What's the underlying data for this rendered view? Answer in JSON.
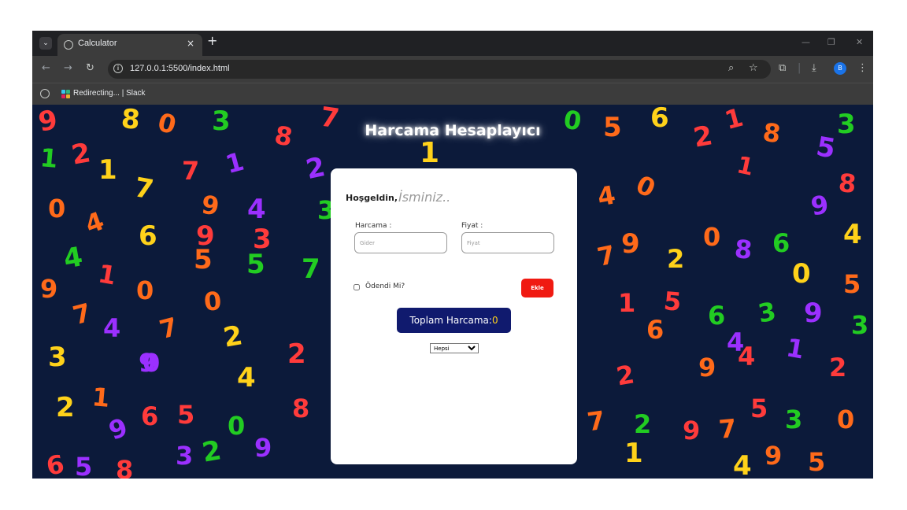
{
  "browser": {
    "tab_title": "Calculator",
    "tab_close": "×",
    "new_tab": "+",
    "tab_menu": "⌄",
    "url": "127.0.0.1:5500/index.html",
    "profile_initial": "B",
    "bookmark_label": "Redirecting... | Slack",
    "icons": [
      "back-icon",
      "forward-icon",
      "reload-icon",
      "info-icon",
      "zoom-icon",
      "star-icon",
      "extensions-icon",
      "download-icon",
      "menu-icon"
    ]
  },
  "page": {
    "title": "Harcama Hesaplayıcı",
    "welcome_label": "Hoşgeldin,",
    "name_placeholder": "İsminiz..",
    "expense_label": "Harcama :",
    "expense_placeholder": "Gider",
    "price_label": "Fiyat :",
    "price_placeholder": "Fiyat",
    "paid_label": "Ödendi Mi?",
    "add_button": "Ekle",
    "total_label": "Toplam Harcama:",
    "total_value": "0",
    "filter_selected": "Hepsi"
  },
  "background_digits": [
    {
      "d": "9",
      "c": "#ff3b3b"
    },
    {
      "d": "8",
      "c": "#ffd21a"
    },
    {
      "d": "0",
      "c": "#ff6a1a"
    },
    {
      "d": "3",
      "c": "#22cc22"
    },
    {
      "d": "8",
      "c": "#ff3b3b"
    },
    {
      "d": "7",
      "c": "#ff3b3b"
    },
    {
      "d": "2",
      "c": "#9b30ff"
    },
    {
      "d": "1",
      "c": "#ffd21a"
    },
    {
      "d": "0",
      "c": "#22cc22"
    },
    {
      "d": "5",
      "c": "#ff6a1a"
    },
    {
      "d": "6",
      "c": "#ffd21a"
    },
    {
      "d": "2",
      "c": "#ff3b3b"
    },
    {
      "d": "1",
      "c": "#ff3b3b"
    },
    {
      "d": "8",
      "c": "#ff6a1a"
    },
    {
      "d": "3",
      "c": "#22cc22"
    },
    {
      "d": "5",
      "c": "#9b30ff"
    },
    {
      "d": "1",
      "c": "#22cc22"
    },
    {
      "d": "2",
      "c": "#ff3b3b"
    },
    {
      "d": "1",
      "c": "#ffd21a"
    },
    {
      "d": "7",
      "c": "#ff3b3b"
    },
    {
      "d": "1",
      "c": "#9b30ff"
    },
    {
      "d": "7",
      "c": "#ffd21a"
    },
    {
      "d": "9",
      "c": "#ff6a1a"
    },
    {
      "d": "4",
      "c": "#9b30ff"
    },
    {
      "d": "0",
      "c": "#ff6a1a"
    },
    {
      "d": "4",
      "c": "#ff6a1a"
    },
    {
      "d": "3",
      "c": "#22cc22"
    },
    {
      "d": "1",
      "c": "#ff3b3b"
    },
    {
      "d": "9",
      "c": "#9b30ff"
    },
    {
      "d": "8",
      "c": "#ff3b3b"
    },
    {
      "d": "4",
      "c": "#ff6a1a"
    },
    {
      "d": "0",
      "c": "#ff6a1a"
    },
    {
      "d": "6",
      "c": "#ffd21a"
    },
    {
      "d": "9",
      "c": "#ff3b3b"
    },
    {
      "d": "3",
      "c": "#ff3b3b"
    },
    {
      "d": "4",
      "c": "#22cc22"
    },
    {
      "d": "7",
      "c": "#ff6a1a"
    },
    {
      "d": "9",
      "c": "#ff6a1a"
    },
    {
      "d": "2",
      "c": "#ffd21a"
    },
    {
      "d": "0",
      "c": "#ff6a1a"
    },
    {
      "d": "8",
      "c": "#9b30ff"
    },
    {
      "d": "6",
      "c": "#22cc22"
    },
    {
      "d": "4",
      "c": "#ffd21a"
    },
    {
      "d": "1",
      "c": "#ff3b3b"
    },
    {
      "d": "5",
      "c": "#ff6a1a"
    },
    {
      "d": "5",
      "c": "#22cc22"
    },
    {
      "d": "7",
      "c": "#22cc22"
    },
    {
      "d": "9",
      "c": "#ff6a1a"
    },
    {
      "d": "0",
      "c": "#ffd21a"
    },
    {
      "d": "5",
      "c": "#ff6a1a"
    },
    {
      "d": "0",
      "c": "#ff6a1a"
    },
    {
      "d": "0",
      "c": "#ff6a1a"
    },
    {
      "d": "7",
      "c": "#ff6a1a"
    },
    {
      "d": "4",
      "c": "#9b30ff"
    },
    {
      "d": "1",
      "c": "#ff3b3b"
    },
    {
      "d": "7",
      "c": "#ff6a1a"
    },
    {
      "d": "5",
      "c": "#ff3b3b"
    },
    {
      "d": "6",
      "c": "#22cc22"
    },
    {
      "d": "3",
      "c": "#22cc22"
    },
    {
      "d": "9",
      "c": "#9b30ff"
    },
    {
      "d": "3",
      "c": "#22cc22"
    },
    {
      "d": "6",
      "c": "#ff6a1a"
    },
    {
      "d": "3",
      "c": "#ffd21a"
    },
    {
      "d": "4",
      "c": "#9b30ff"
    },
    {
      "d": "0",
      "c": "#9b30ff"
    },
    {
      "d": "2",
      "c": "#ffd21a"
    },
    {
      "d": "2",
      "c": "#ff3b3b"
    },
    {
      "d": "4",
      "c": "#ff3b3b"
    },
    {
      "d": "1",
      "c": "#9b30ff"
    },
    {
      "d": "4",
      "c": "#ffd21a"
    },
    {
      "d": "9",
      "c": "#9b30ff"
    },
    {
      "d": "9",
      "c": "#ff6a1a"
    },
    {
      "d": "2",
      "c": "#ff3b3b"
    },
    {
      "d": "2",
      "c": "#ff3b3b"
    },
    {
      "d": "2",
      "c": "#ffd21a"
    },
    {
      "d": "1",
      "c": "#ff6a1a"
    },
    {
      "d": "9",
      "c": "#9b30ff"
    },
    {
      "d": "6",
      "c": "#ff3b3b"
    },
    {
      "d": "5",
      "c": "#ff3b3b"
    },
    {
      "d": "8",
      "c": "#ff3b3b"
    },
    {
      "d": "5",
      "c": "#ff3b3b"
    },
    {
      "d": "7",
      "c": "#ff6a1a"
    },
    {
      "d": "2",
      "c": "#22cc22"
    },
    {
      "d": "9",
      "c": "#ff3b3b"
    },
    {
      "d": "7",
      "c": "#ff6a1a"
    },
    {
      "d": "3",
      "c": "#22cc22"
    },
    {
      "d": "0",
      "c": "#ff6a1a"
    },
    {
      "d": "0",
      "c": "#22cc22"
    },
    {
      "d": "2",
      "c": "#22cc22"
    },
    {
      "d": "3",
      "c": "#9b30ff"
    },
    {
      "d": "9",
      "c": "#9b30ff"
    },
    {
      "d": "6",
      "c": "#ff3b3b"
    },
    {
      "d": "5",
      "c": "#9b30ff"
    },
    {
      "d": "8",
      "c": "#ff3b3b"
    },
    {
      "d": "1",
      "c": "#ffd21a"
    },
    {
      "d": "4",
      "c": "#ffd21a"
    },
    {
      "d": "9",
      "c": "#ff6a1a"
    },
    {
      "d": "5",
      "c": "#ff6a1a"
    }
  ]
}
